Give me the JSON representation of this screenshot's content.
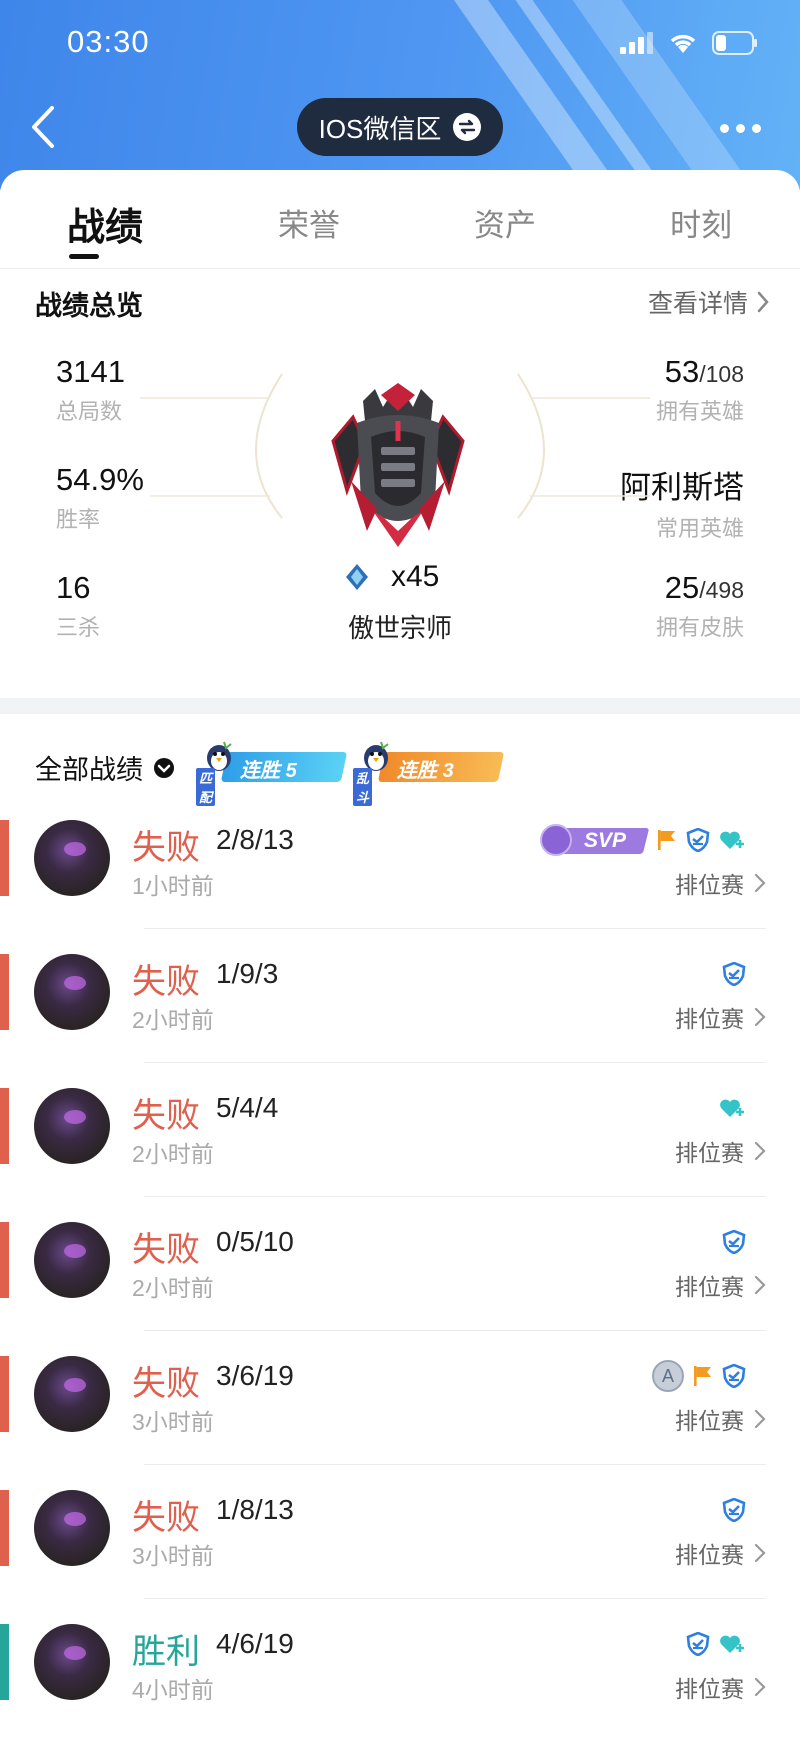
{
  "status_bar": {
    "time": "03:30"
  },
  "header": {
    "region": "IOS微信区"
  },
  "tabs": [
    {
      "label": "战绩",
      "active": true
    },
    {
      "label": "荣誉",
      "active": false
    },
    {
      "label": "资产",
      "active": false
    },
    {
      "label": "时刻",
      "active": false
    }
  ],
  "overview": {
    "title": "战绩总览",
    "detail_link": "查看详情",
    "total_games": {
      "value": "3141",
      "label": "总局数"
    },
    "win_rate": {
      "value": "54.9%",
      "label": "胜率"
    },
    "triple_kills": {
      "value": "16",
      "label": "三杀"
    },
    "heroes": {
      "value": "53",
      "total": "/108",
      "label": "拥有英雄"
    },
    "favorite_hero": {
      "value": "阿利斯塔",
      "label": "常用英雄"
    },
    "skins": {
      "value": "25",
      "total": "/498",
      "label": "拥有皮肤"
    },
    "rank": {
      "stars": "x45",
      "name": "傲世宗师"
    }
  },
  "records": {
    "title": "全部战绩",
    "streaks": [
      {
        "small": "匹配",
        "text": "连胜",
        "count": "5",
        "color": "#39b8ef"
      },
      {
        "small": "乱斗",
        "text": "连胜",
        "count": "3",
        "color": "#f5a53c"
      }
    ]
  },
  "matches": [
    {
      "result": "失败",
      "kda": "2/8/13",
      "time": "1小时前",
      "mode": "排位赛",
      "badges": [
        "svp-badge",
        "flag-icon",
        "shield-icon",
        "heart-plus-icon"
      ],
      "svp_text": "SVP"
    },
    {
      "result": "失败",
      "kda": "1/9/3",
      "time": "2小时前",
      "mode": "排位赛",
      "badges": [
        "shield-icon"
      ]
    },
    {
      "result": "失败",
      "kda": "5/4/4",
      "time": "2小时前",
      "mode": "排位赛",
      "badges": [
        "heart-plus-icon"
      ]
    },
    {
      "result": "失败",
      "kda": "0/5/10",
      "time": "2小时前",
      "mode": "排位赛",
      "badges": [
        "shield-icon"
      ]
    },
    {
      "result": "失败",
      "kda": "3/6/19",
      "time": "3小时前",
      "mode": "排位赛",
      "badges": [
        "a-badge",
        "flag-icon",
        "shield-icon"
      ],
      "a_text": "A"
    },
    {
      "result": "失败",
      "kda": "1/8/13",
      "time": "3小时前",
      "mode": "排位赛",
      "badges": [
        "shield-icon"
      ]
    },
    {
      "result": "胜利",
      "kda": "4/6/19",
      "time": "4小时前",
      "mode": "排位赛",
      "badges": [
        "shield-icon",
        "heart-plus-icon"
      ]
    }
  ],
  "colors": {
    "header_blue": "#3f86ea",
    "loss": "#e0604e",
    "win": "#26a69a",
    "badge_blue": "#2f7fe0",
    "badge_teal": "#34c3c7",
    "flag_orange": "#f39a1f"
  }
}
